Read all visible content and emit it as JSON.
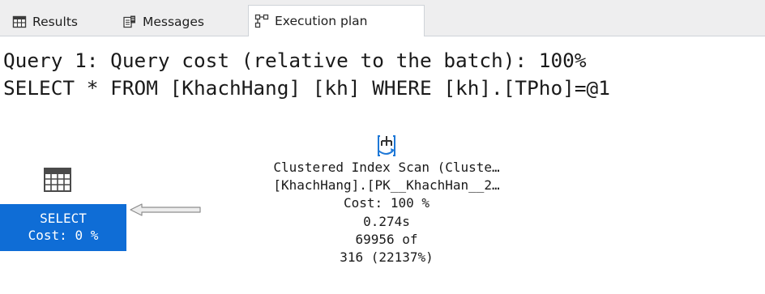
{
  "tabs": [
    {
      "label": "Results",
      "icon": "grid-icon",
      "active": false
    },
    {
      "label": "Messages",
      "icon": "messages-icon",
      "active": false
    },
    {
      "label": "Execution plan",
      "icon": "execution-plan-icon",
      "active": true
    }
  ],
  "query": {
    "header": "Query 1: Query cost (relative to the batch): 100%",
    "sql": "SELECT * FROM [KhachHang] [kh] WHERE [kh].[TPho]=@1"
  },
  "plan": {
    "select_node": {
      "icon": "select-operator-icon",
      "label": "SELECT",
      "cost": "Cost: 0 %"
    },
    "scan_node": {
      "icon": "clustered-index-scan-icon",
      "title": "Clustered Index Scan (Cluste…",
      "object": "[KhachHang].[PK__KhachHan__2…",
      "cost": "Cost: 100 %",
      "time": "0.274s",
      "rows_actual": "69956 of",
      "rows_estimated": "316 (22137%)"
    }
  },
  "colors": {
    "selected_node_bg": "#0f6dd6",
    "tabbar_bg": "#eeeeef",
    "icon_blue": "#1e78d7"
  }
}
